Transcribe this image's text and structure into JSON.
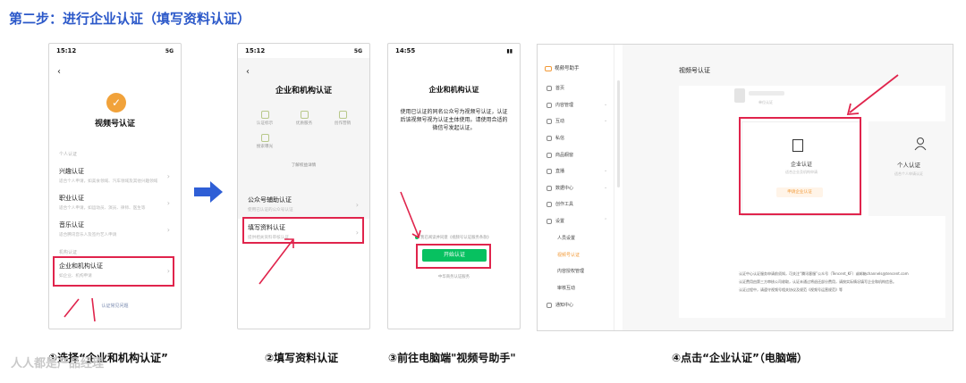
{
  "title": "第二步：进行企业认证（填写资料认证）",
  "phone1": {
    "time": "15:12",
    "net": "5G",
    "heading": "视频号认证",
    "section_personal": "个人认证",
    "items": [
      {
        "title": "兴趣认证",
        "sub": "适合个人申请，如美食领域、汽车领域及其他兴趣领域"
      },
      {
        "title": "职业认证",
        "sub": "适合个人申请，如运动员、演员、律师、医生等"
      },
      {
        "title": "音乐认证",
        "sub": "适合腾讯音乐人及签约艺人申请"
      }
    ],
    "section_org": "机构认证",
    "org_item": {
      "title": "企业和机构认证",
      "sub": "如企业、机构申请"
    },
    "faq": "认证常见问题"
  },
  "phone2": {
    "time": "15:12",
    "net": "5G",
    "heading": "企业和机构认证",
    "features": [
      "认证标示",
      "优质服务",
      "创作营销",
      "搜索曝光"
    ],
    "more": "了解权益详情",
    "items": [
      {
        "title": "公众号辅助认证",
        "sub": "使用已认证的公众号认证"
      },
      {
        "title": "填写资料认证",
        "sub": "提供相关资料审核认证"
      }
    ]
  },
  "phone3": {
    "time": "14:55",
    "heading": "企业和机构认证",
    "desc": "使用已认证的同名公众号为视频号认证，认证后该视频号视为认证主体使用。请使用合适的微信号发起认证。",
    "agree": "我已阅读并同意《视频号认证服务条款》",
    "button": "开始认证",
    "hint": "中华商务认证服务"
  },
  "pc": {
    "brand": "视频号助手",
    "nav": [
      "首页",
      "内容管理",
      "互动",
      "私信",
      "商品橱窗",
      "直播",
      "数据中心",
      "创作工具",
      "设置"
    ],
    "subnav": [
      "人员设置",
      "视频号认证",
      "内容授权管理",
      "审核互动"
    ],
    "nav_bottom": "通知中心",
    "page_title": "视频号认证",
    "account_label": "单位认证",
    "biz": {
      "title": "企业认证",
      "sub": "适合企业及机构申请",
      "button": "申请企业认证"
    },
    "personal": {
      "title": "个人认证",
      "sub": "适合个人申请认证"
    },
    "notes": [
      "认证中心认证服务申请前须知，可关注“腾讯客服”公众号（Tencent_KF）或邮箱channels@tencent.com",
      "认证费用由第三方审核公司收取，认证未通过将退还部分费用，请按实际情况填写企业和机构信息。",
      "认证过程中，请遵守视频号相关协议及规范《视频号运营规范》等"
    ]
  },
  "captions": [
    "①选择“企业和机构认证”",
    "②填写资料认证",
    "③前往电脑端\"视频号助手\"",
    "④点击“企业认证”（电脑端）"
  ],
  "watermark": "人人都是产品经理"
}
